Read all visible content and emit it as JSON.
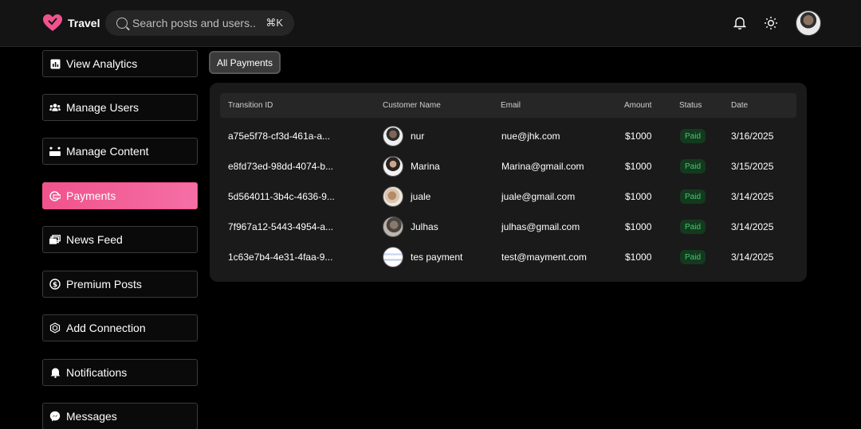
{
  "header": {
    "brand": "Travel",
    "search": {
      "placeholder": "Search posts and users..",
      "shortcut": "⌘K"
    },
    "icons": [
      "bell-icon",
      "sun-icon"
    ],
    "accent_color": "#f0538c"
  },
  "sidebar": {
    "items": [
      {
        "label": "View Analytics",
        "icon": "chart-icon",
        "active": false
      },
      {
        "label": "Manage Users",
        "icon": "users-icon",
        "active": false
      },
      {
        "label": "Manage Content",
        "icon": "content-icon",
        "active": false
      },
      {
        "label": "Payments",
        "icon": "payment-icon",
        "active": true
      },
      {
        "label": "News Feed",
        "icon": "news-icon",
        "active": false
      },
      {
        "label": "Premium Posts",
        "icon": "dollar-icon",
        "active": false
      },
      {
        "label": "Add Connection",
        "icon": "hexagon-icon",
        "active": false
      },
      {
        "label": "Notifications",
        "icon": "bell-icon",
        "active": false
      },
      {
        "label": "Messages",
        "icon": "messenger-icon",
        "active": false
      }
    ]
  },
  "main": {
    "tab_label": "All Payments",
    "table": {
      "columns": [
        "Transition ID",
        "Customer Name",
        "Email",
        "Amount",
        "Status",
        "Date"
      ],
      "rows": [
        {
          "id": "a75e5f78-cf3d-461a-a...",
          "name": "nur",
          "email": "nue@jhk.com",
          "amount": "$1000",
          "status": "Paid",
          "date": "3/16/2025"
        },
        {
          "id": "e8fd73ed-98dd-4074-b...",
          "name": "Marina",
          "email": "Marina@gmail.com",
          "amount": "$1000",
          "status": "Paid",
          "date": "3/15/2025"
        },
        {
          "id": "5d564011-3b4c-4636-9...",
          "name": "juale",
          "email": "juale@gmail.com",
          "amount": "$1000",
          "status": "Paid",
          "date": "3/14/2025"
        },
        {
          "id": "7f967a12-5443-4954-a...",
          "name": "Julhas",
          "email": "julhas@gmail.com",
          "amount": "$1000",
          "status": "Paid",
          "date": "3/14/2025"
        },
        {
          "id": "1c63e7b4-4e31-4faa-9...",
          "name": "tes payment",
          "email": "test@mayment.com",
          "amount": "$1000",
          "status": "Paid",
          "date": "3/14/2025"
        }
      ]
    }
  }
}
